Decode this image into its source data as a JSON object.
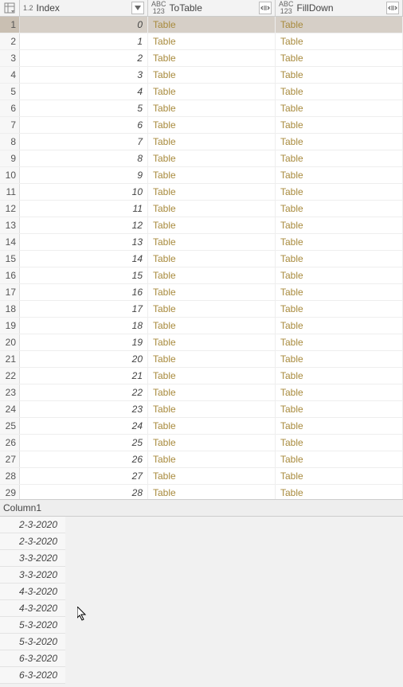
{
  "columns": {
    "index": {
      "label": "Index",
      "typeIcon": "1.2"
    },
    "toTable": {
      "label": "ToTable",
      "typeIcon": "ABC\n123"
    },
    "fill": {
      "label": "FillDown",
      "typeIcon": "ABC\n123"
    }
  },
  "linkText": "Table",
  "rows": [
    {
      "n": 1,
      "i": 0
    },
    {
      "n": 2,
      "i": 1
    },
    {
      "n": 3,
      "i": 2
    },
    {
      "n": 4,
      "i": 3
    },
    {
      "n": 5,
      "i": 4
    },
    {
      "n": 6,
      "i": 5
    },
    {
      "n": 7,
      "i": 6
    },
    {
      "n": 8,
      "i": 7
    },
    {
      "n": 9,
      "i": 8
    },
    {
      "n": 10,
      "i": 9
    },
    {
      "n": 11,
      "i": 10
    },
    {
      "n": 12,
      "i": 11
    },
    {
      "n": 13,
      "i": 12
    },
    {
      "n": 14,
      "i": 13
    },
    {
      "n": 15,
      "i": 14
    },
    {
      "n": 16,
      "i": 15
    },
    {
      "n": 17,
      "i": 16
    },
    {
      "n": 18,
      "i": 17
    },
    {
      "n": 19,
      "i": 18
    },
    {
      "n": 20,
      "i": 19
    },
    {
      "n": 21,
      "i": 20
    },
    {
      "n": 22,
      "i": 21
    },
    {
      "n": 23,
      "i": 22
    },
    {
      "n": 24,
      "i": 23
    },
    {
      "n": 25,
      "i": 24
    },
    {
      "n": 26,
      "i": 25
    },
    {
      "n": 27,
      "i": 26
    },
    {
      "n": 28,
      "i": 27
    },
    {
      "n": 29,
      "i": 28
    }
  ],
  "selectedRow": 1,
  "preview": {
    "header": "Column1",
    "values": [
      "2-3-2020",
      "2-3-2020",
      "3-3-2020",
      "3-3-2020",
      "4-3-2020",
      "4-3-2020",
      "5-3-2020",
      "5-3-2020",
      "6-3-2020",
      "6-3-2020"
    ]
  }
}
